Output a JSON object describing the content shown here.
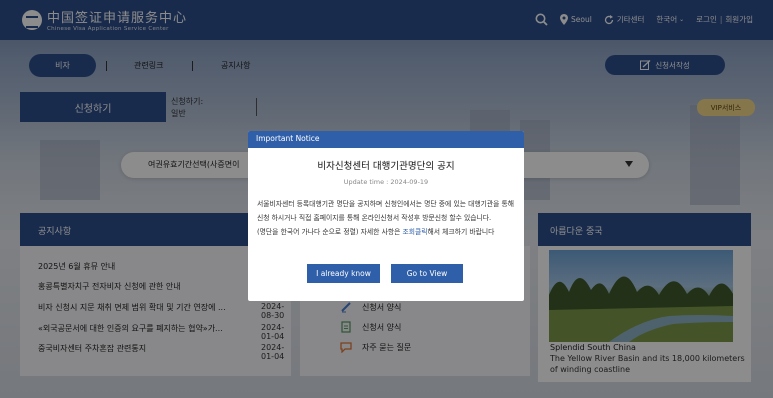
{
  "header": {
    "logo_cn": "中国签证申请服务中心",
    "logo_en": "Chinese Visa Application Service Center",
    "location": "Seoul",
    "other_center": "기타센터",
    "language": "한국어",
    "login": "로그인",
    "register": "회원가입"
  },
  "tabs": {
    "visa": "비자",
    "links": "관련링크",
    "notices": "공지사항",
    "apply_form": "신청서작성"
  },
  "apply": {
    "tab_label": "신청하기",
    "type_label": "신청하기:",
    "type_value": "일반",
    "vip": "VIP서비스"
  },
  "dropdown": {
    "value": "여권유효기간선택(사증면이"
  },
  "notice_section": {
    "title": "공지사항",
    "items": [
      {
        "title": "2025년 6월 휴뮤 안내",
        "date": "20"
      },
      {
        "title": "홍콩특별자치구 전자비자 신청에 관한 안내",
        "date": "20"
      },
      {
        "title": "비자 신청시 지문 채취 면제 범위 확대 및 기간 연장에 ...",
        "date": "2024-08-30"
      },
      {
        "title": "«외국공문서에 대한 인증의 요구를 폐지하는 협약»가...",
        "date": "2024-01-04"
      },
      {
        "title": "중국비자센터 주차혼잡 관련통지",
        "date": "2024-01-04"
      }
    ]
  },
  "services": {
    "items": [
      {
        "label": "신청서 양식",
        "icon": "pen-icon",
        "color": "#4a7fd0"
      },
      {
        "label": "신청서 양식",
        "icon": "document-icon",
        "color": "#5aa36b"
      },
      {
        "label": "자주 묻는 질문",
        "icon": "chat-icon",
        "color": "#e0793a"
      }
    ]
  },
  "beauty": {
    "title": "아름다운 중국",
    "caption1": "Splendid South China",
    "caption2": "The Yellow River Basin and its 18,000 kilometers of winding coastline"
  },
  "modal": {
    "header": "Important Notice",
    "title": "비자신청센터 대행기관명단의 공지",
    "date": "Update time : 2024-09-19",
    "body1": "서울비자센터 등록대행기관 명단을 공지하며 신청인에서는 명단 중에 있는 대행기관을 통해 신청 하시거나 직접 홈페이지를 통해 온라인신청서 작성후 방문신청 할수 있습니다.",
    "body2_pre": "(명단을 한국어 가나다 순으로 정렬) 자세한 사항은 ",
    "body2_link": "조회클릭",
    "body2_post": "해서 체크하기 바랍니다",
    "btn_know": "I already know",
    "btn_view": "Go to View"
  },
  "colors": {
    "primary": "#2f4f8c",
    "modal_blue": "#2f5fa9",
    "vip": "#f4d789"
  }
}
